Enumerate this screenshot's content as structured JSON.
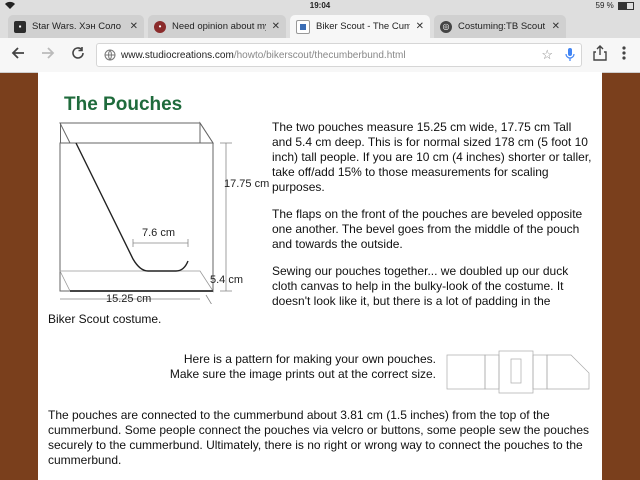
{
  "status_bar": {
    "time": "19:04",
    "battery": "59 %"
  },
  "tabs": [
    {
      "title": "Star Wars. Хэн Соло и га",
      "active": false
    },
    {
      "title": "Need opinion about my Sc",
      "active": false
    },
    {
      "title": "Biker Scout - The Cummer",
      "active": true
    },
    {
      "title": "Costuming:TB Scout troo",
      "active": false
    }
  ],
  "toolbar": {
    "url_host": "www.studiocreations.com",
    "url_path": "/howto/bikerscout/thecumberbund.html"
  },
  "page": {
    "heading": "The Pouches",
    "diagram": {
      "height_label": "17.75 cm",
      "bevel_label": "7.6 cm",
      "depth_label": "5.4 cm",
      "width_label": "15.25 cm"
    },
    "para1": "The two pouches measure 15.25 cm wide, 17.75 cm Tall and 5.4 cm deep. This is for normal sized 178 cm (5 foot 10 inch) tall people. If you are 10 cm (4 inches) shorter or taller, take off/add 15% to those measurements for scaling purposes.",
    "para2": "The flaps on the front of the pouches are beveled opposite one another. The bevel goes from the middle of the pouch and towards the outside.",
    "para3_right": "Sewing our pouches together... we doubled up our duck cloth canvas to help in the bulky-look of the costume. It doesn't look like it, but there is a lot of padding in the",
    "para3_wrap": "Biker Scout costume.",
    "pattern_text": "Here is a pattern for making your own pouches. Make sure the image prints out at the correct size.",
    "para4": "The pouches are connected to the cummerbund about 3.81 cm (1.5 inches) from the top of the cummerbund. Some people connect the pouches via velcro or buttons, some people sew the pouches securely to the cummerbund. Ultimately, there is no right or wrong way to connect the pouches to the cummerbund."
  }
}
